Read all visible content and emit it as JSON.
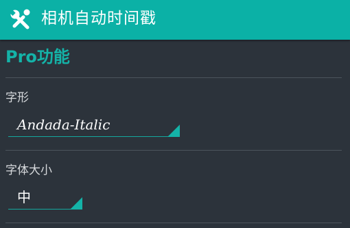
{
  "app_bar": {
    "icon": "tools-icon",
    "title": "相机自动时间戳"
  },
  "section": {
    "title": "Pro功能"
  },
  "settings": {
    "font": {
      "label": "字形",
      "value": "Andada-Italic"
    },
    "font_size": {
      "label": "字体大小",
      "value": "中"
    }
  },
  "colors": {
    "app_bar": "#0bb1a6",
    "background": "#2c333b",
    "accent": "#14b3a8"
  }
}
